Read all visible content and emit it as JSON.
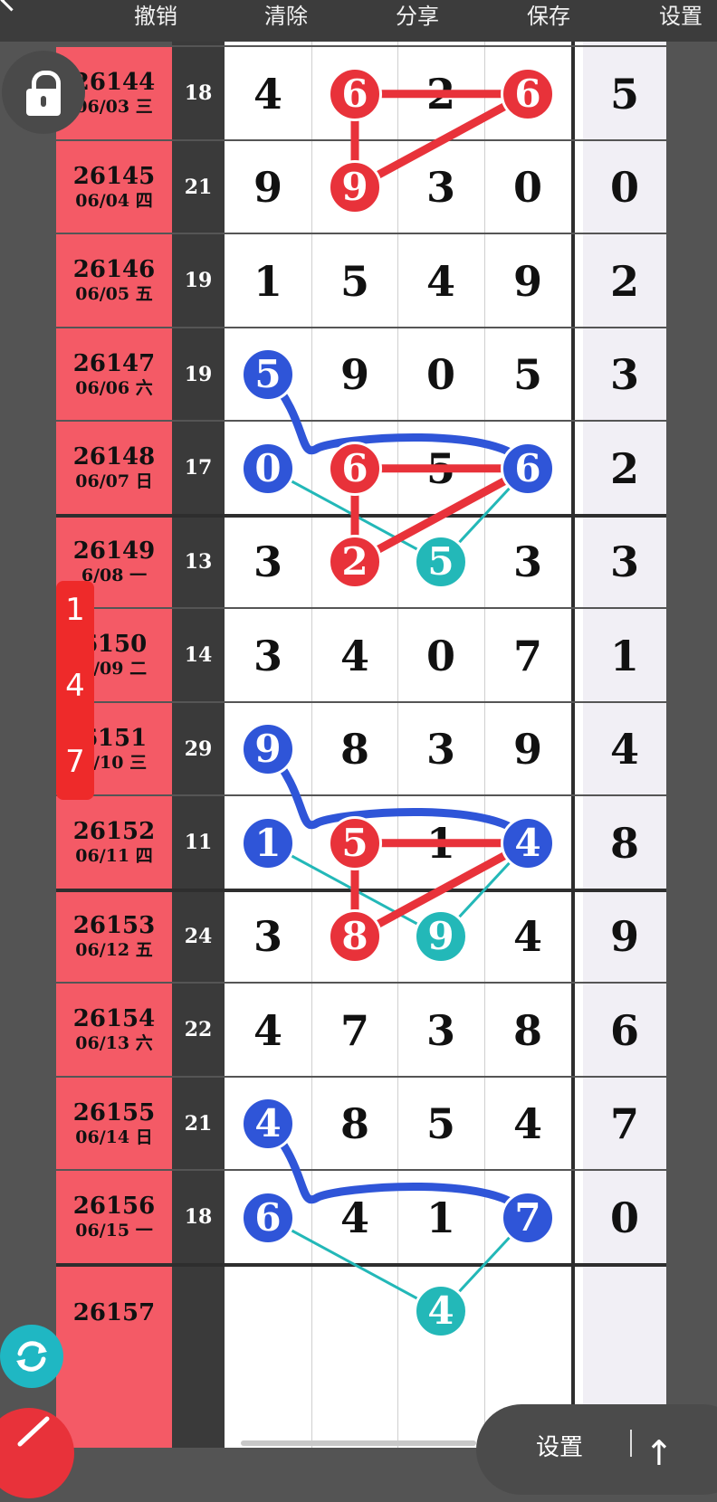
{
  "toolbar": {
    "undo": "撤销",
    "clear": "清除",
    "share": "分享",
    "save": "保存",
    "settings": "设置"
  },
  "rows": [
    {
      "issue": "26144",
      "date": "06/03 三",
      "sum": "18",
      "digits": [
        "4",
        "6",
        "2",
        "6"
      ],
      "last": "5"
    },
    {
      "issue": "26145",
      "date": "06/04 四",
      "sum": "21",
      "digits": [
        "9",
        "9",
        "3",
        "0"
      ],
      "last": "0"
    },
    {
      "issue": "26146",
      "date": "06/05 五",
      "sum": "19",
      "digits": [
        "1",
        "5",
        "4",
        "9"
      ],
      "last": "2"
    },
    {
      "issue": "26147",
      "date": "06/06 六",
      "sum": "19",
      "digits": [
        "5",
        "9",
        "0",
        "5"
      ],
      "last": "3"
    },
    {
      "issue": "26148",
      "date": "06/07 日",
      "sum": "17",
      "digits": [
        "0",
        "6",
        "5",
        "6"
      ],
      "last": "2"
    },
    {
      "issue": "26149",
      "date": "6/08 一",
      "sum": "13",
      "digits": [
        "3",
        "2",
        "5",
        "3"
      ],
      "last": "3"
    },
    {
      "issue": "6150",
      "date": "6/09 二",
      "sum": "14",
      "digits": [
        "3",
        "4",
        "0",
        "7"
      ],
      "last": "1"
    },
    {
      "issue": "6151",
      "date": "6/10 三",
      "sum": "29",
      "digits": [
        "9",
        "8",
        "3",
        "9"
      ],
      "last": "4"
    },
    {
      "issue": "26152",
      "date": "06/11 四",
      "sum": "11",
      "digits": [
        "1",
        "5",
        "1",
        "4"
      ],
      "last": "8"
    },
    {
      "issue": "26153",
      "date": "06/12 五",
      "sum": "24",
      "digits": [
        "3",
        "8",
        "9",
        "4"
      ],
      "last": "9"
    },
    {
      "issue": "26154",
      "date": "06/13 六",
      "sum": "22",
      "digits": [
        "4",
        "7",
        "3",
        "8"
      ],
      "last": "6"
    },
    {
      "issue": "26155",
      "date": "06/14 日",
      "sum": "21",
      "digits": [
        "4",
        "8",
        "5",
        "4"
      ],
      "last": "7"
    },
    {
      "issue": "26156",
      "date": "06/15 一",
      "sum": "18",
      "digits": [
        "6",
        "4",
        "1",
        "7"
      ],
      "last": "0"
    },
    {
      "issue": "26157",
      "date": "",
      "sum": "",
      "digits": [
        "",
        "",
        "4",
        ""
      ],
      "last": ""
    }
  ],
  "marks": [
    {
      "row": 0,
      "col": 1,
      "color": "red"
    },
    {
      "row": 0,
      "col": 3,
      "color": "red"
    },
    {
      "row": 1,
      "col": 1,
      "color": "red"
    },
    {
      "row": 3,
      "col": 0,
      "color": "blue"
    },
    {
      "row": 4,
      "col": 0,
      "color": "blue"
    },
    {
      "row": 4,
      "col": 1,
      "color": "red"
    },
    {
      "row": 4,
      "col": 3,
      "color": "blue"
    },
    {
      "row": 5,
      "col": 1,
      "color": "red"
    },
    {
      "row": 5,
      "col": 2,
      "color": "teal"
    },
    {
      "row": 7,
      "col": 0,
      "color": "blue"
    },
    {
      "row": 8,
      "col": 0,
      "color": "blue"
    },
    {
      "row": 8,
      "col": 1,
      "color": "red"
    },
    {
      "row": 8,
      "col": 3,
      "color": "blue"
    },
    {
      "row": 9,
      "col": 1,
      "color": "red"
    },
    {
      "row": 9,
      "col": 2,
      "color": "teal"
    },
    {
      "row": 11,
      "col": 0,
      "color": "blue"
    },
    {
      "row": 12,
      "col": 0,
      "color": "blue"
    },
    {
      "row": 12,
      "col": 3,
      "color": "blue"
    },
    {
      "row": 13,
      "col": 2,
      "color": "teal"
    }
  ],
  "side_pill": {
    "items": [
      "1",
      "4",
      "7"
    ]
  },
  "icons": {
    "lock": "lock-icon",
    "refresh": "refresh-icon",
    "pen": "pen-icon",
    "back": "back-arrow-icon"
  },
  "colors": {
    "date_bg": "#f45a66",
    "red_ball": "#e8323a",
    "blue_ball": "#2f55d8",
    "teal_ball": "#23b8b8"
  },
  "bottom_menu": {
    "label": "设置",
    "arrow": "↑"
  }
}
